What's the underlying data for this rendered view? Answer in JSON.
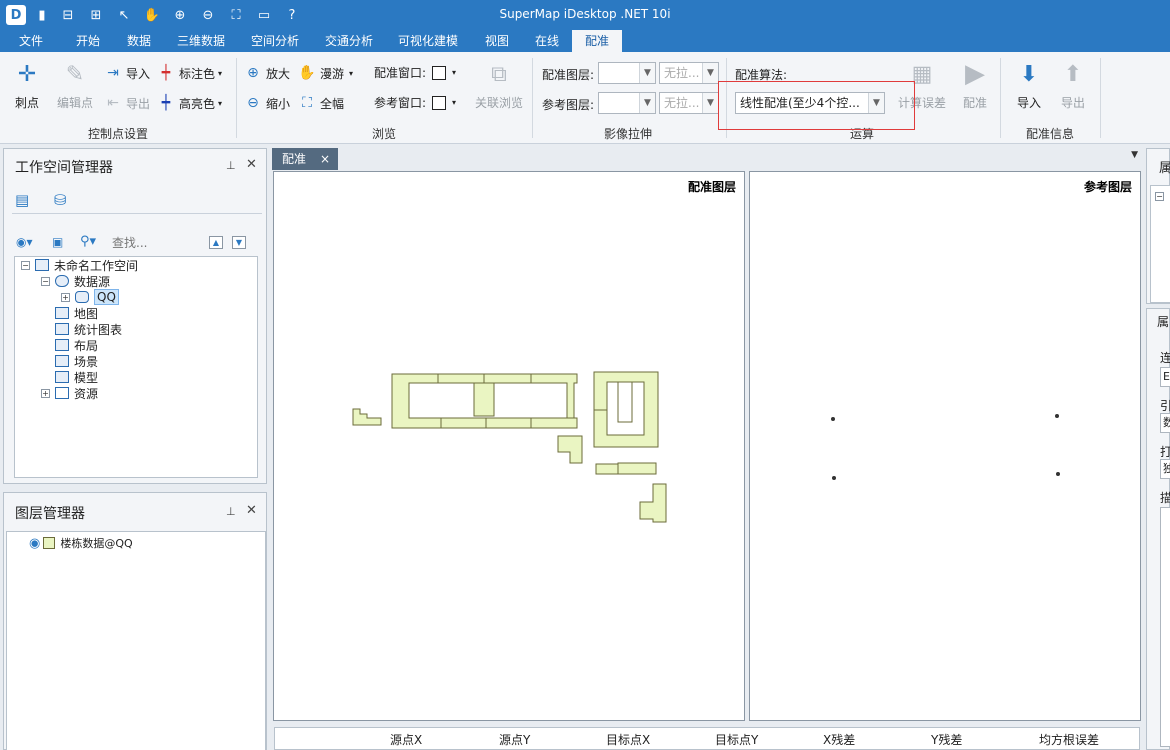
{
  "app": {
    "title": "SuperMap iDesktop .NET 10i",
    "quick_access": [
      "app-logo-icon",
      "save-icon",
      "window-icon",
      "window-icon",
      "pointer-icon",
      "pan-icon",
      "zoom-in-icon",
      "zoom-out-icon",
      "full-extent-icon",
      "open-folder-icon",
      "help-icon"
    ]
  },
  "ribbon": {
    "tabs": [
      "文件",
      "开始",
      "数据",
      "三维数据",
      "空间分析",
      "交通分析",
      "可视化建模",
      "视图",
      "在线",
      "配准"
    ],
    "active_tab": "配准",
    "control_points": {
      "label": "控制点设置",
      "prick": "刺点",
      "edit_point": "编辑点",
      "import": "导入",
      "export": "导出",
      "label_color": "标注色",
      "highlight_color": "高亮色"
    },
    "browse": {
      "label": "浏览",
      "zoom_in": "放大",
      "zoom_out": "缩小",
      "roam": "漫游",
      "full_extent": "全幅",
      "register_window": "配准窗口:",
      "reference_window": "参考窗口:",
      "linked_browse": "关联浏览"
    },
    "stretch": {
      "label": "影像拉伸",
      "register_layer": "配准图层:",
      "reference_layer": "参考图层:",
      "no_stretch": "无拉..."
    },
    "compute": {
      "label": "运算",
      "algorithm_label": "配准算法:",
      "algorithm_value": "线性配准(至少4个控...",
      "calc_error": "计算误差",
      "register": "配准"
    },
    "info": {
      "label": "配准信息",
      "import": "导入",
      "export": "导出"
    }
  },
  "workspace_manager": {
    "title": "工作空间管理器",
    "search_placeholder": "查找...",
    "tree": [
      {
        "label": "未命名工作空间",
        "level": 0,
        "expander": "−"
      },
      {
        "label": "数据源",
        "level": 1,
        "expander": "−"
      },
      {
        "label": "QQ",
        "level": 2,
        "expander": "+",
        "selected": true
      },
      {
        "label": "地图",
        "level": 1,
        "expander": ""
      },
      {
        "label": "统计图表",
        "level": 1,
        "expander": ""
      },
      {
        "label": "布局",
        "level": 1,
        "expander": ""
      },
      {
        "label": "场景",
        "level": 1,
        "expander": ""
      },
      {
        "label": "模型",
        "level": 1,
        "expander": ""
      },
      {
        "label": "资源",
        "level": 1,
        "expander": "+"
      }
    ]
  },
  "layer_manager": {
    "title": "图层管理器",
    "layers": [
      "楼栋数据@QQ"
    ]
  },
  "document": {
    "tab": "配准",
    "close": "×",
    "register_map_title": "配准图层",
    "reference_map_title": "参考图层"
  },
  "grid_columns": [
    "源点X",
    "源点Y",
    "目标点X",
    "目标点Y",
    "X残差",
    "Y残差",
    "均方根误差"
  ],
  "right_panel": {
    "title_fragment": "属",
    "section2_fragment": "属",
    "labels": [
      "连",
      "引",
      "打",
      "描"
    ],
    "values": [
      "E",
      "数",
      "独"
    ]
  },
  "colors": {
    "titlebar": "#2b79c2",
    "polygon_fill": "#eaf5c2",
    "polygon_stroke": "#6b6b3a",
    "highlight_border": "#e03b3b"
  }
}
